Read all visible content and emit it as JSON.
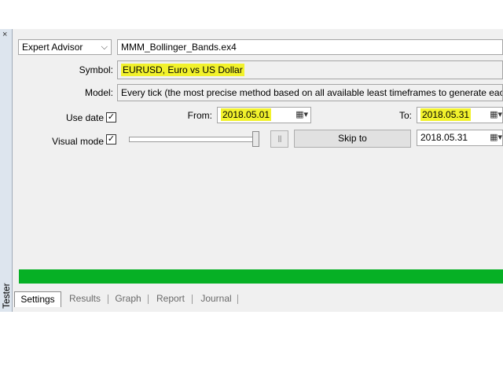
{
  "window": {
    "side_label": "Tester",
    "close_glyph": "×"
  },
  "settings": {
    "program_type": "Expert Advisor",
    "expert_file": "MMM_Bollinger_Bands.ex4",
    "symbol_label": "Symbol:",
    "symbol_value": "EURUSD, Euro vs US Dollar",
    "model_label": "Model:",
    "model_value": "Every tick (the most precise method based on all available least timeframes to generate each tick)",
    "use_date_label": "Use date",
    "use_date_checked": "✓",
    "from_label": "From:",
    "from_value": "2018.05.01",
    "to_label": "To:",
    "to_value": "2018.05.31",
    "visual_mode_label": "Visual mode",
    "visual_mode_checked": "✓",
    "pause_glyph": "II",
    "skip_to_label": "Skip to",
    "skip_to_date": "2018.05.31"
  },
  "progress": {
    "percent": 100,
    "color": "#06b025"
  },
  "highlight_color": "#f2f22c",
  "tabs": [
    {
      "label": "Settings",
      "active": true
    },
    {
      "label": "Results"
    },
    {
      "label": "Graph"
    },
    {
      "label": "Report"
    },
    {
      "label": "Journal"
    }
  ],
  "icons": {
    "dropdown": "chevron-down-icon",
    "calendar": "calendar-icon"
  }
}
